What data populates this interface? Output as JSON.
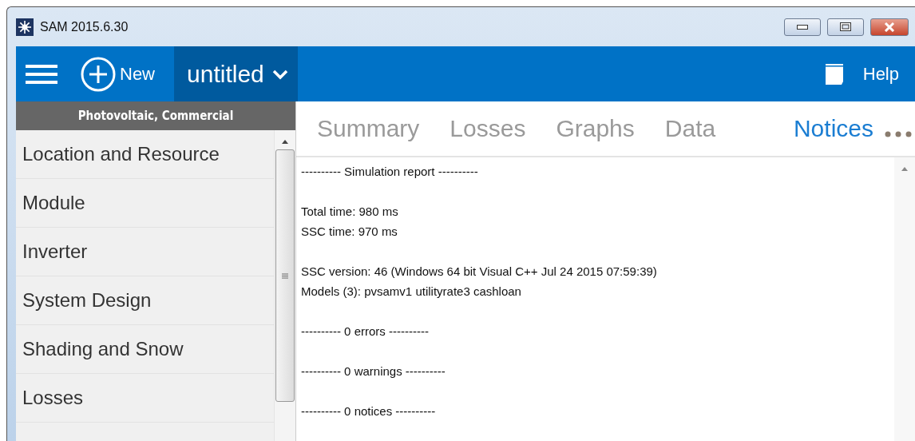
{
  "window": {
    "title": "SAM 2015.6.30"
  },
  "toolbar": {
    "new_label": "New",
    "file_name": "untitled",
    "help_label": "Help"
  },
  "sidebar": {
    "header": "Photovoltaic, Commercial",
    "items": [
      {
        "label": "Location and Resource",
        "selected": false
      },
      {
        "label": "Module",
        "selected": false
      },
      {
        "label": "Inverter",
        "selected": false
      },
      {
        "label": "System Design",
        "selected": false
      },
      {
        "label": "Shading and Snow",
        "selected": false
      },
      {
        "label": "Losses",
        "selected": false
      }
    ]
  },
  "tabs": [
    {
      "label": "Summary",
      "selected": false
    },
    {
      "label": "Losses",
      "selected": false
    },
    {
      "label": "Graphs",
      "selected": false
    },
    {
      "label": "Data",
      "selected": false
    },
    {
      "label": "Notices",
      "selected": true
    }
  ],
  "report": [
    [
      "---------- Simulation report ----------"
    ],
    [
      "Total time: 980 ms",
      "SSC time: 970 ms"
    ],
    [
      "SSC version: 46 (Windows 64 bit Visual C++ Jul 24 2015 07:59:39)",
      "Models (3): pvsamv1 utilityrate3 cashloan"
    ],
    [
      "---------- 0 errors ----------"
    ],
    [
      "---------- 0 warnings ----------"
    ],
    [
      "---------- 0 notices ----------"
    ]
  ]
}
